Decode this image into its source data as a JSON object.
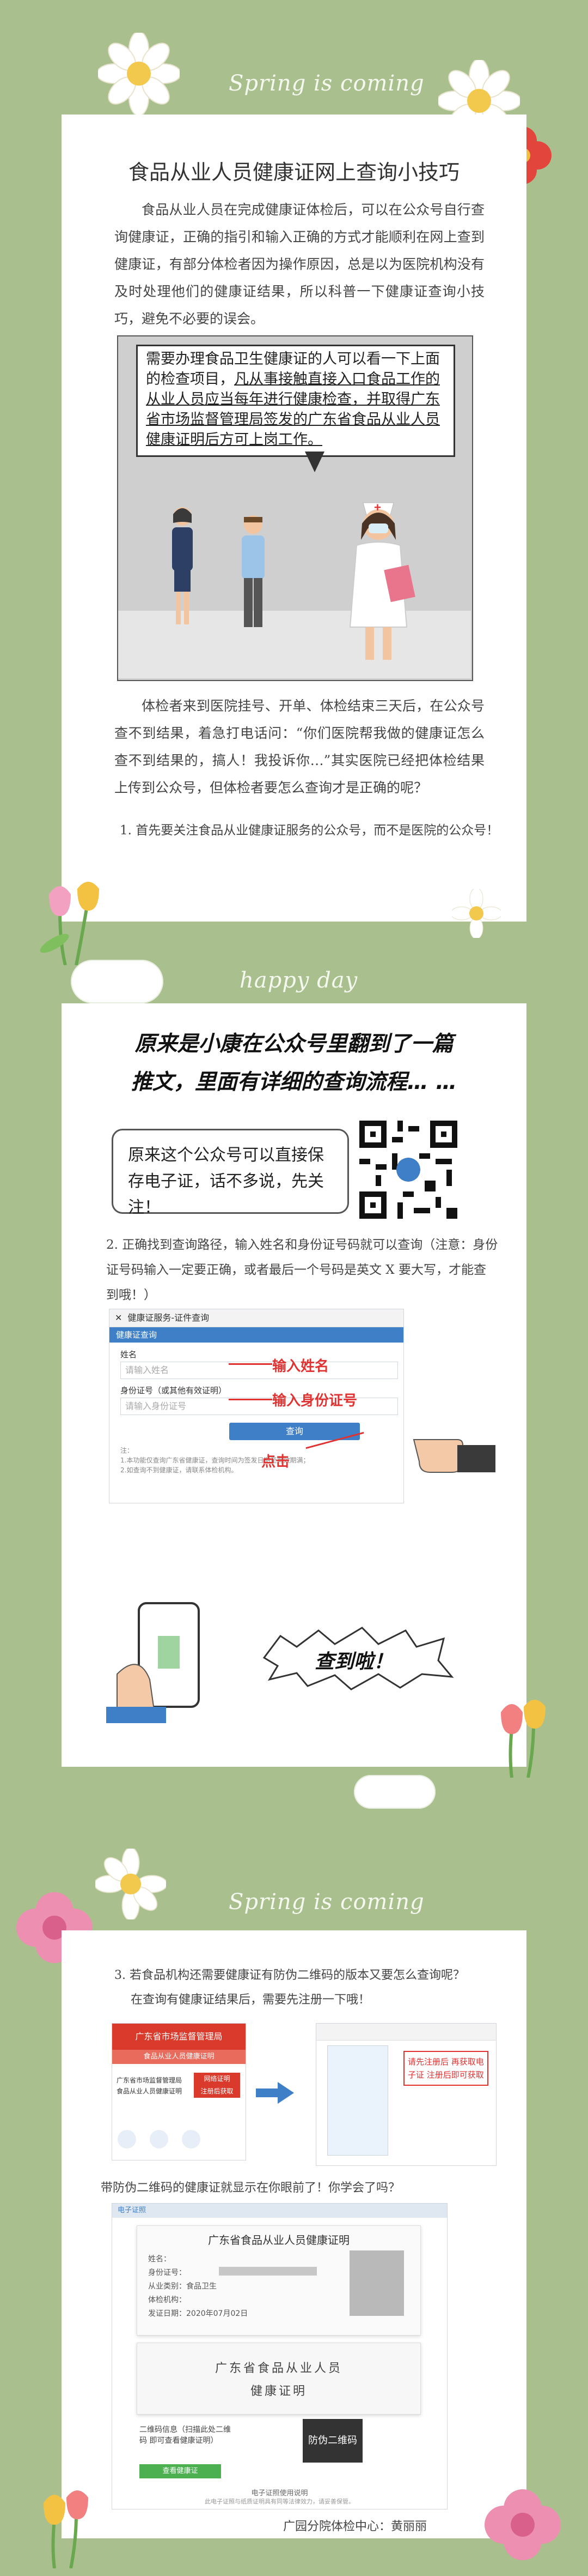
{
  "header": {
    "script": "Spring is coming"
  },
  "article": {
    "title": "食品从业人员健康证网上查询小技巧",
    "intro": "食品从业人员在完成健康证体检后，可以在公众号自行查询健康证，正确的指引和输入正确的方式才能顺利在网上查到健康证，有部分体检者因为操作原因，总是以为医院机构没有及时处理他们的健康证结果，所以科普一下健康证查询小技巧，避免不必要的误会。",
    "comic_text_plain": "需要办理食品卫生健康证的人可以看一下上面的检查项目，",
    "comic_text_underlined": "凡从事接触直接入口食品工作的从业人员应当每年进行健康检查，并取得广东省市场监督管理局签发的广东省食品从业人员健康证明后方可上岗工作。",
    "nurse_badge": "+",
    "para2": "体检者来到医院挂号、开单、体检结束三天后，在公众号查不到结果，着急打电话问：“你们医院帮我做的健康证怎么查不到结果的，搞人！我投诉你…”其实医院已经把体检结果上传到公众号，但体检者要怎么查询才是正确的呢？",
    "step1": "1. 首先要关注食品从业健康证服务的公众号，而不是医院的公众号！"
  },
  "section2": {
    "script": "happy day",
    "banner_line1": "原来是小康在公众号里翻到了一篇",
    "banner_line2": "推文，里面有详细的查询流程…  …",
    "bubble_text": "原来这个公众号可以直接保存电子证，话不多说，先关注！",
    "step2": "2. 正确找到查询路径，输入姓名和身份证号码就可以查询（注意：身份证号码输入一定要正确，或者最后一个号码是英文 X 要大写，才能查到哦！）",
    "form": {
      "window_title": "健康证服务-证件查询",
      "tab": "健康证查询",
      "name_label": "姓名",
      "name_placeholder": "请输入姓名",
      "id_label": "身份证号（或其他有效证明）",
      "id_placeholder": "请输入身份证号",
      "query_button": "查询",
      "notes": "注：\n1.本功能仅查询广东省健康证，查询时间为签发日期至有效期满；\n2.如查询不到健康证，请联系体检机构。",
      "annot_name": "输入姓名",
      "annot_id": "输入身份证号",
      "annot_click": "点击"
    },
    "found_bubble": "查到啦！"
  },
  "section3": {
    "script": "Spring is coming",
    "step3_line1": "3. 若食品机构还需要健康证有防伪二维码的版本又要怎么查询呢？",
    "step3_line2": "在查询有健康证结果后，需要先注册一下哦！",
    "left_shot": {
      "header": "广东省市场监督管理局",
      "sub": "食品从业人员健康证明",
      "line1": "广东省市场监督管理局",
      "line2": "食品从业人员健康证明",
      "red_btn": "网络证明",
      "red_btn2": "注册后获取"
    },
    "right_shot": {
      "note": "请先注册后 再获取电子证 注册后即可获取"
    },
    "summary": "带防伪二维码的健康证就显示在你眼前了！你学会了吗？",
    "certificate": {
      "top_tab": "电子证照",
      "title": "广东省食品从业人员健康证明",
      "rows": [
        "姓名：",
        "身份证号：",
        "从业类别：食品卫生",
        "体检机构：",
        "发证日期：2020年07月02日"
      ],
      "seal_line1": "广东省食品从业人员",
      "seal_line2": "健康证明",
      "qr_caption": "二维码信息（扫描此处二维码 即可查看健康证明）",
      "stamp": "防伪二维码",
      "green_button": "查看健康证",
      "footer_line1": "电子证照使用说明",
      "footer_line2": "此电子证照与纸质证明具有同等法律效力，请妥善保管。"
    },
    "credit": "广园分院体检中心：黄丽丽"
  },
  "colors": {
    "background": "#a9c08e",
    "accent_red": "#e13232",
    "accent_blue": "#3e7fc7",
    "nurse_pink": "#e8758b"
  }
}
